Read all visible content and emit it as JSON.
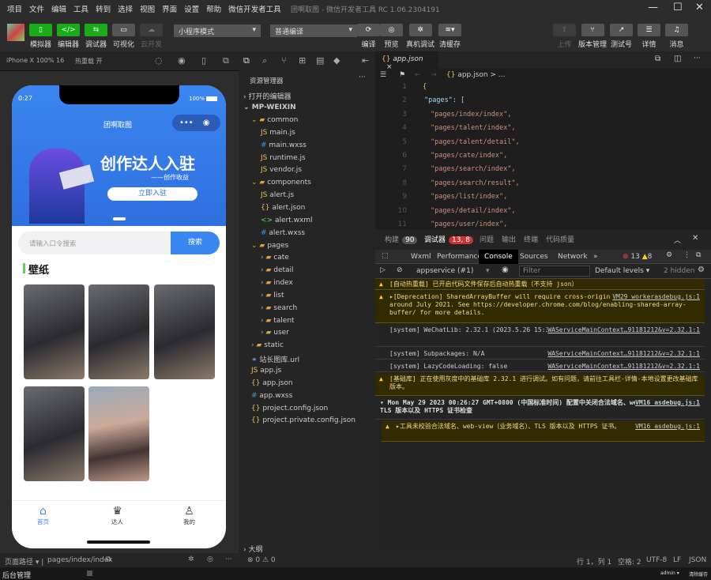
{
  "menu": [
    "项目",
    "文件",
    "编辑",
    "工具",
    "转到",
    "选择",
    "视图",
    "界面",
    "设置",
    "帮助",
    "微信开发者工具"
  ],
  "window_title": "团啊取图 - 微信开发者工具 RC 1.06.2304191",
  "toolbar": {
    "simulator": "模拟器",
    "editor": "编辑器",
    "debugger": "调试器",
    "visual": "可视化",
    "cloud": "云开发",
    "mode": "小程序模式",
    "compile_mode": "普通编译",
    "compile": "编译",
    "preview": "预览",
    "real_debug": "真机调试",
    "clear_cache": "清缓存",
    "upload": "上传",
    "version": "版本管理",
    "test_id": "测试号",
    "details": "详情",
    "messages": "消息"
  },
  "sim": {
    "device": "iPhone X 100% 16",
    "hot_reload": "热重载 开",
    "time": "0:27",
    "battery": "100%",
    "nav_title": "团啊取图",
    "banner_title": "创作达人入驻",
    "banner_sub": "——创作收益",
    "banner_btn": "立即入驻",
    "search_placeholder": "请输入口令搜索",
    "search_btn": "搜索",
    "section": "壁纸",
    "tabs": [
      "首页",
      "达人",
      "我的"
    ]
  },
  "explorer": {
    "title": "资源管理器",
    "open_editors": "打开的编辑器",
    "project": "MP-WEIXIN",
    "items": [
      [
        "common",
        1,
        "folder"
      ],
      [
        "main.js",
        2,
        "js"
      ],
      [
        "main.wxss",
        2,
        "wxss"
      ],
      [
        "runtime.js",
        2,
        "js"
      ],
      [
        "vendor.js",
        2,
        "js"
      ],
      [
        "components",
        1,
        "folder"
      ],
      [
        "alert.js",
        2,
        "js"
      ],
      [
        "alert.json",
        2,
        "json"
      ],
      [
        "alert.wxml",
        2,
        "wxml"
      ],
      [
        "alert.wxss",
        2,
        "wxss"
      ],
      [
        "pages",
        1,
        "folder"
      ],
      [
        "cate",
        2,
        "folderc"
      ],
      [
        "detail",
        2,
        "folderc"
      ],
      [
        "index",
        2,
        "folderc"
      ],
      [
        "list",
        2,
        "folderc"
      ],
      [
        "search",
        2,
        "folderc"
      ],
      [
        "talent",
        2,
        "folderc"
      ],
      [
        "user",
        2,
        "folderc"
      ],
      [
        "static",
        1,
        "folderc"
      ],
      [
        "站长图库.url",
        1,
        "url"
      ],
      [
        "app.js",
        1,
        "js"
      ],
      [
        "app.json",
        1,
        "json"
      ],
      [
        "app.wxss",
        1,
        "wxss"
      ],
      [
        "project.config.json",
        1,
        "json"
      ],
      [
        "project.private.config.json",
        1,
        "json"
      ]
    ],
    "outline": "大纲"
  },
  "editor": {
    "tab": "app.json",
    "breadcrumb": "app.json > ...",
    "lines": [
      "{",
      "\"pages\": [",
      "\"pages/index/index\",",
      "\"pages/talent/index\",",
      "\"pages/talent/detail\",",
      "\"pages/cate/index\",",
      "\"pages/search/index\",",
      "\"pages/search/result\",",
      "\"pages/list/index\",",
      "\"pages/detail/index\",",
      "\"pages/user/index\","
    ]
  },
  "debug": {
    "tabs": [
      {
        "label": "构建",
        "badge": "90"
      },
      {
        "label": "调试器",
        "badge": "13, 8"
      },
      {
        "label": "问题"
      },
      {
        "label": "输出"
      },
      {
        "label": "终端"
      },
      {
        "label": "代码质量"
      }
    ],
    "devtabs": [
      "Wxml",
      "Performance",
      "Console",
      "Sources",
      "Network",
      "»"
    ],
    "errors": "13",
    "warnings": "8",
    "context": "appservice (#1)",
    "filter": "Filter",
    "levels": "Default levels",
    "hidden": "2 hidden",
    "messages": [
      {
        "type": "warn",
        "text": "[自动热重载] 已开启代码文件保存后自动热重载（不支持 json）",
        "src": ""
      },
      {
        "type": "warn",
        "text": "▸[Deprecation] SharedArrayBuffer will require cross-origin isolation as of M92, around July 2021. See https://developer.chrome.com/blog/enabling-shared-array-buffer/ for more details.",
        "src": "VM29 workerasdebug.js:1"
      },
      {
        "type": "info",
        "text": "[system] WeChatLib: 2.32.1 (2023.5.26 15:39:08)",
        "src": "WAServiceMainContext…91181212&v=2.32.1:1"
      },
      {
        "type": "info",
        "text": "[system] Subpackages: N/A",
        "src": "WAServiceMainContext…91181212&v=2.32.1:1"
      },
      {
        "type": "info",
        "text": "[system] LazyCodeLoading: false",
        "src": "WAServiceMainContext…91181212&v=2.32.1:1"
      },
      {
        "type": "warn",
        "text": "[基础库] 正在使用灰度中的基础库 2.32.1 进行调试。如有问题，请前往工具栏-详情-本地设置更改基础库版本。",
        "src": ""
      },
      {
        "type": "group",
        "text": "▾ Mon May 29 2023 00:26:27 GMT+0800 (中国标准时间) 配置中关闭合法域名、web-view（业务域名）、TLS 版本以及 HTTPS 证书检查",
        "src": "VM16 asdebug.js:1"
      },
      {
        "type": "warn",
        "text": "▸工具未校验合法域名、web-view（业务域名）、TLS 版本以及 HTTPS 证书。",
        "src": "VM16 asdebug.js:1"
      }
    ]
  },
  "status": {
    "page_path_label": "页面路径",
    "page_path": "pages/index/index",
    "problems": "⊗ 0 ⚠ 0",
    "cursor": "行 1，列 1",
    "spaces": "空格: 2",
    "encoding": "UTF-8",
    "eol": "LF",
    "lang": "JSON"
  },
  "taskbar": {
    "app": "后台管理",
    "user": "admin ▾",
    "clear": "清除缓存"
  }
}
